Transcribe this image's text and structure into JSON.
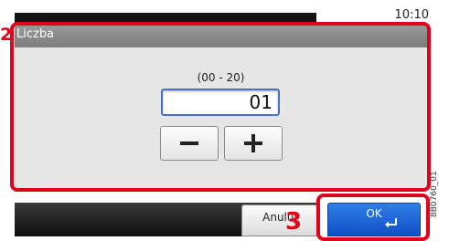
{
  "status_bar": {
    "time": "10:10"
  },
  "dialog": {
    "title": "Liczba",
    "range": "(00 - 20)",
    "value": "01"
  },
  "buttons": {
    "cancel_label": "Anuluj",
    "ok_label": "OK"
  },
  "callouts": {
    "step_2": "2",
    "step_3": "3"
  },
  "figure_code": "8B0760_01",
  "colors": {
    "accent_red": "#e2001a",
    "ok_blue": "#1a62d6",
    "input_border": "#4a72c4"
  },
  "icons": {
    "minus": "minus-icon",
    "plus": "plus-icon",
    "enter": "enter-icon"
  }
}
